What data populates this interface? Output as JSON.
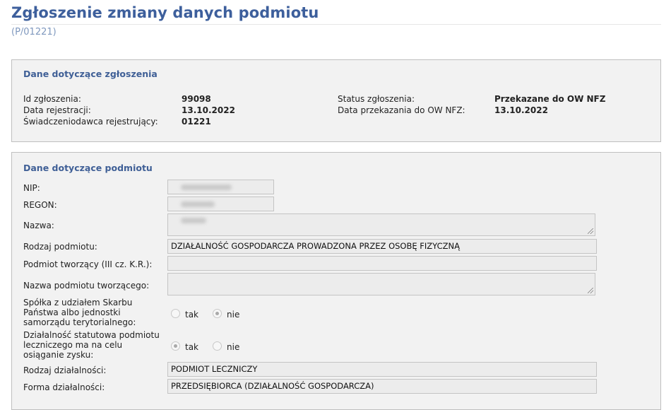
{
  "page": {
    "title": "Zgłoszenie zmiany danych podmiotu",
    "code": "(P/01221)"
  },
  "submission": {
    "heading": "Dane dotyczące zgłoszenia",
    "id_label": "Id zgłoszenia:",
    "id_value": "99098",
    "reg_date_label": "Data rejestracji:",
    "reg_date_value": "13.10.2022",
    "provider_label": "Świadczeniodawca rejestrujący:",
    "provider_value": "01221",
    "status_label": "Status zgłoszenia:",
    "status_value": "Przekazane do OW NFZ",
    "transfer_date_label": "Data przekazania do OW NFZ:",
    "transfer_date_value": "13.10.2022"
  },
  "entity": {
    "heading": "Dane dotyczące podmiotu",
    "nip_label": "NIP:",
    "regon_label": "REGON:",
    "name_label": "Nazwa:",
    "type_label": "Rodzaj podmiotu:",
    "type_value": "DZIAŁALNOŚĆ GOSPODARCZA PROWADZONA PRZEZ OSOBĘ FIZYCZNĄ",
    "founder_label": "Podmiot tworzący (III cz. K.R.):",
    "founder_value": "",
    "founder_name_label": "Nazwa podmiotu tworzącego:",
    "founder_name_value": "",
    "state_company_label": "Spółka z udziałem Skarbu Państwa albo jednostki samorządu terytorialnego:",
    "state_company_options": [
      "tak",
      "nie"
    ],
    "state_company_selected": "nie",
    "profit_label": "Działalność statutowa podmiotu leczniczego ma na celu osiąganie zysku:",
    "profit_options": [
      "tak",
      "nie"
    ],
    "profit_selected": "tak",
    "activity_type_label": "Rodzaj działalności:",
    "activity_type_value": "PODMIOT LECZNICZY",
    "activity_form_label": "Forma działalności:",
    "activity_form_value": "PRZEDSIĘBIORCA (DZIAŁALNOŚĆ GOSPODARCZA)"
  }
}
